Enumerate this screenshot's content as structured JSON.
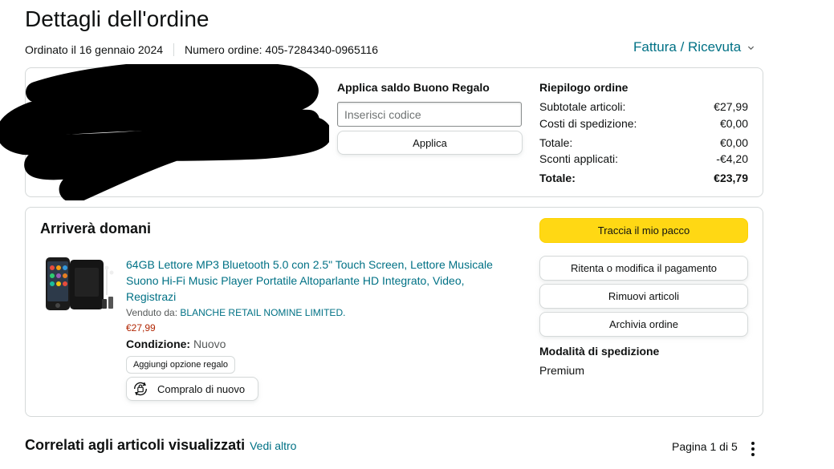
{
  "header": {
    "title": "Dettagli dell'ordine",
    "ordered_on": "Ordinato il 16 gennaio 2024",
    "order_number": "Numero ordine: 405-7284340-0965116",
    "invoice_label": "Fattura / Ricevuta"
  },
  "gift_card": {
    "title": "Applica saldo Buono Regalo",
    "placeholder": "Inserisci codice",
    "apply_label": "Applica"
  },
  "summary": {
    "title": "Riepilogo ordine",
    "rows": [
      {
        "label": "Subtotale articoli:",
        "value": "€27,99"
      },
      {
        "label": "Costi di spedizione:",
        "value": "€0,00"
      },
      {
        "label": "Totale:",
        "value": "€0,00"
      },
      {
        "label": "Sconti applicati:",
        "value": "-€4,20"
      }
    ],
    "grand_total": {
      "label": "Totale:",
      "value": "€23,79"
    }
  },
  "shipment": {
    "arrival": "Arrivera domani",
    "product_title": "64GB Lettore MP3 Bluetooth 5.0 con 2.5\" Touch Screen, Lettore Musicale Suono Hi-Fi Music Player Portatile Altoparlante HD Integrato, Video, Registrazi",
    "sold_by_label": "Venduto da:",
    "seller": "BLANCHE RETAIL NOMINE LIMITED.",
    "price": "€27,99",
    "condition_label": "Condizione:",
    "condition_value": "Nuovo",
    "gift_option_label": "Aggiungi opzione regalo",
    "buy_again_label": "Compralo di nuovo",
    "actions": {
      "track": "Traccia il mio pacco",
      "retry_payment": "Ritenta o modifica il pagamento",
      "remove_items": "Rimuovi articoli",
      "archive": "Archivia ordine"
    },
    "shipping_mode_title": "Modalità di spedizione",
    "shipping_mode_value": "Premium"
  },
  "related": {
    "title": "Correlati agli articoli visualizzati",
    "see_more": "Vedi altro",
    "pagination": "Pagina 1 di 5"
  },
  "colors": {
    "link": "#007185",
    "price": "#b12704",
    "primary_button": "#ffd814",
    "border": "#d5d9d9"
  },
  "icons": [
    "chevron-down-icon",
    "buy-again-icon",
    "kebab-menu-icon"
  ]
}
